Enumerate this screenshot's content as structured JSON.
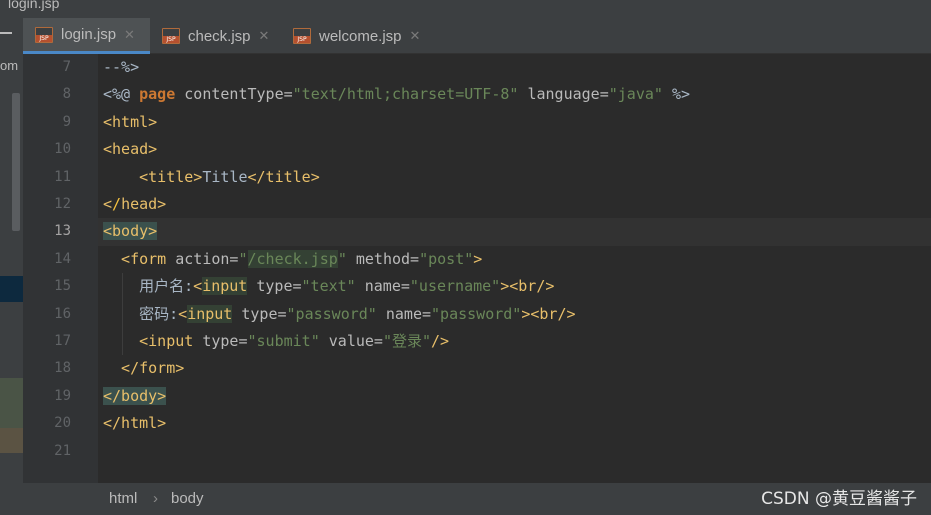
{
  "window": {
    "title": "login.jsp"
  },
  "sidebar": {
    "label": "om"
  },
  "tabs": [
    {
      "label": "login.jsp",
      "active": true
    },
    {
      "label": "check.jsp",
      "active": false
    },
    {
      "label": "welcome.jsp",
      "active": false
    }
  ],
  "editor": {
    "current_line": 13,
    "line_numbers": [
      "7",
      "8",
      "9",
      "10",
      "11",
      "12",
      "13",
      "14",
      "15",
      "16",
      "17",
      "18",
      "19",
      "20",
      "21"
    ],
    "lines": [
      [
        {
          "t": "--%>",
          "c": "txt"
        }
      ],
      [
        {
          "t": "<%@ ",
          "c": "txt"
        },
        {
          "t": "page",
          "c": "kw"
        },
        {
          "t": " contentType=",
          "c": "attr"
        },
        {
          "t": "\"text/html;charset=UTF-8\"",
          "c": "val"
        },
        {
          "t": " language=",
          "c": "attr"
        },
        {
          "t": "\"java\"",
          "c": "val"
        },
        {
          "t": " %>",
          "c": "txt"
        }
      ],
      [
        {
          "t": "<html>",
          "c": "tag"
        }
      ],
      [
        {
          "t": "<head>",
          "c": "tag"
        }
      ],
      [
        {
          "t": "    <title>",
          "c": "tag"
        },
        {
          "t": "Title",
          "c": "txt"
        },
        {
          "t": "</title>",
          "c": "tag"
        }
      ],
      [
        {
          "t": "<",
          "c": "tag"
        },
        {
          "t": "/",
          "c": "bulb"
        },
        {
          "t": "head>",
          "c": "tag"
        }
      ],
      [
        {
          "t": "<body>",
          "c": "tag hl"
        }
      ],
      [
        {
          "t": "  <form ",
          "c": "tag"
        },
        {
          "t": "action=",
          "c": "attr"
        },
        {
          "t": "\"",
          "c": "val"
        },
        {
          "t": "/check.jsp",
          "c": "val hl2"
        },
        {
          "t": "\"",
          "c": "val"
        },
        {
          "t": " method=",
          "c": "attr"
        },
        {
          "t": "\"post\"",
          "c": "val"
        },
        {
          "t": ">",
          "c": "tag"
        }
      ],
      [
        {
          "t": "    用户名:",
          "c": "txt"
        },
        {
          "t": "<",
          "c": "tag"
        },
        {
          "t": "input",
          "c": "tag hl2"
        },
        {
          "t": " type=",
          "c": "attr"
        },
        {
          "t": "\"text\"",
          "c": "val"
        },
        {
          "t": " name=",
          "c": "attr"
        },
        {
          "t": "\"username\"",
          "c": "val"
        },
        {
          "t": "><br/>",
          "c": "tag"
        }
      ],
      [
        {
          "t": "    密码:",
          "c": "txt"
        },
        {
          "t": "<",
          "c": "tag"
        },
        {
          "t": "input",
          "c": "tag hl2"
        },
        {
          "t": " type=",
          "c": "attr"
        },
        {
          "t": "\"password\"",
          "c": "val"
        },
        {
          "t": " name=",
          "c": "attr"
        },
        {
          "t": "\"password\"",
          "c": "val"
        },
        {
          "t": "><br/>",
          "c": "tag"
        }
      ],
      [
        {
          "t": "    <input ",
          "c": "tag"
        },
        {
          "t": "type=",
          "c": "attr"
        },
        {
          "t": "\"submit\"",
          "c": "val"
        },
        {
          "t": " value=",
          "c": "attr"
        },
        {
          "t": "\"登录\"",
          "c": "val"
        },
        {
          "t": "/>",
          "c": "tag"
        }
      ],
      [
        {
          "t": "  </form>",
          "c": "tag"
        }
      ],
      [
        {
          "t": "</body>",
          "c": "tag hl"
        }
      ],
      [
        {
          "t": "</html>",
          "c": "tag"
        }
      ],
      []
    ]
  },
  "statusbar": {
    "breadcrumbs": [
      "html",
      "body"
    ],
    "separator": "›",
    "watermark": "CSDN @黄豆酱酱子"
  },
  "colors": {
    "tag": "#e8bf6a",
    "attribute": "#bababa",
    "value": "#6a8759",
    "keyword": "#cc7832",
    "accent": "#4a88c7"
  }
}
